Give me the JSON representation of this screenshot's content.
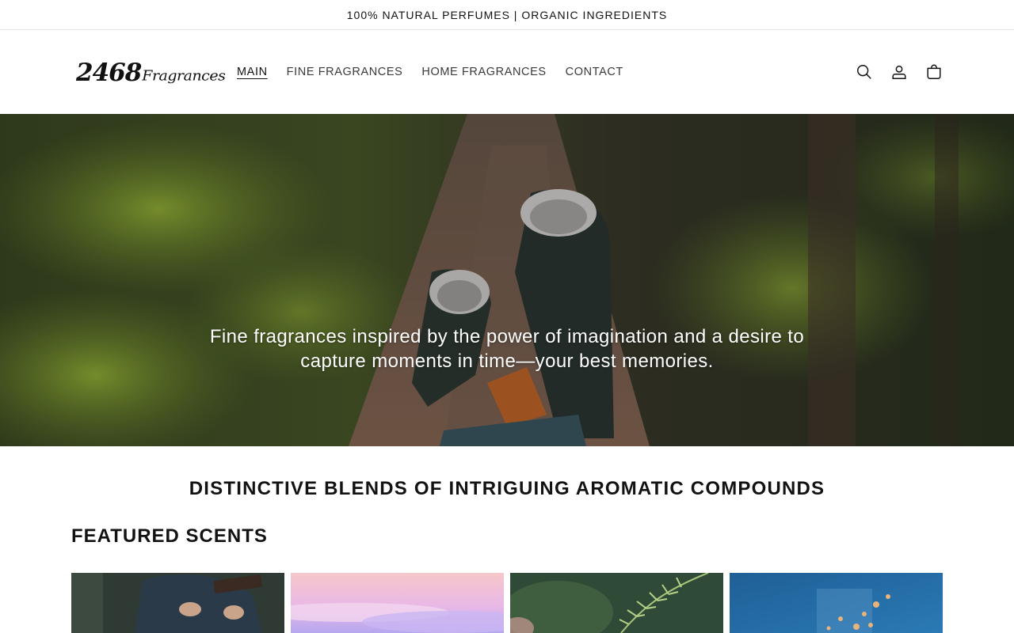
{
  "announcement": {
    "text": "100% NATURAL PERFUMES | ORGANIC INGREDIENTS"
  },
  "header": {
    "logo": {
      "number": "2468",
      "script": "Fragrances"
    },
    "nav": [
      {
        "label": "MAIN",
        "active": true
      },
      {
        "label": "FINE FRAGRANCES",
        "active": false
      },
      {
        "label": "HOME FRAGRANCES",
        "active": false
      },
      {
        "label": "CONTACT",
        "active": false
      }
    ],
    "icons": [
      "search-icon",
      "account-icon",
      "cart-icon"
    ]
  },
  "hero": {
    "text_line1": "Fine fragrances inspired by the power of imagination and a desire to",
    "text_line2": "capture moments in time—your best memories."
  },
  "tagline": "DISTINCTIVE BLENDS OF INTRIGUING AROMATIC COMPOUNDS",
  "featured": {
    "title": "FEATURED SCENTS",
    "cards": [
      {
        "image": "person-reading-book-in-forest"
      },
      {
        "image": "pink-sunset-clouds"
      },
      {
        "image": "green-fern-leaves"
      },
      {
        "image": "blue-jar-with-lights"
      }
    ]
  },
  "colors": {
    "text": "#121212",
    "border": "#e6e6e6",
    "background": "#ffffff"
  }
}
